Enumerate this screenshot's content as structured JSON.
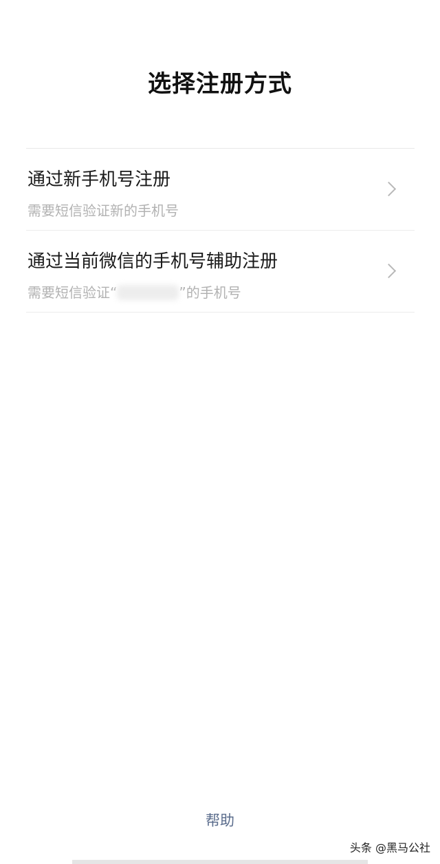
{
  "page": {
    "title": "选择注册方式"
  },
  "options": [
    {
      "title": "通过新手机号注册",
      "subtitle": "需要短信验证新的手机号"
    },
    {
      "title": "通过当前微信的手机号辅助注册",
      "subtitle_prefix": "需要短信验证“",
      "subtitle_suffix": "”的手机号"
    }
  ],
  "footer": {
    "help_label": "帮助",
    "watermark": "头条 @黑马公社"
  },
  "colors": {
    "background": "#ffffff",
    "title_text": "#111111",
    "subtitle_text": "#b2b2b2",
    "help_link": "#5a6c8c",
    "divider": "#e8e8e8"
  },
  "icons": {
    "chevron": "chevron-right-icon"
  }
}
